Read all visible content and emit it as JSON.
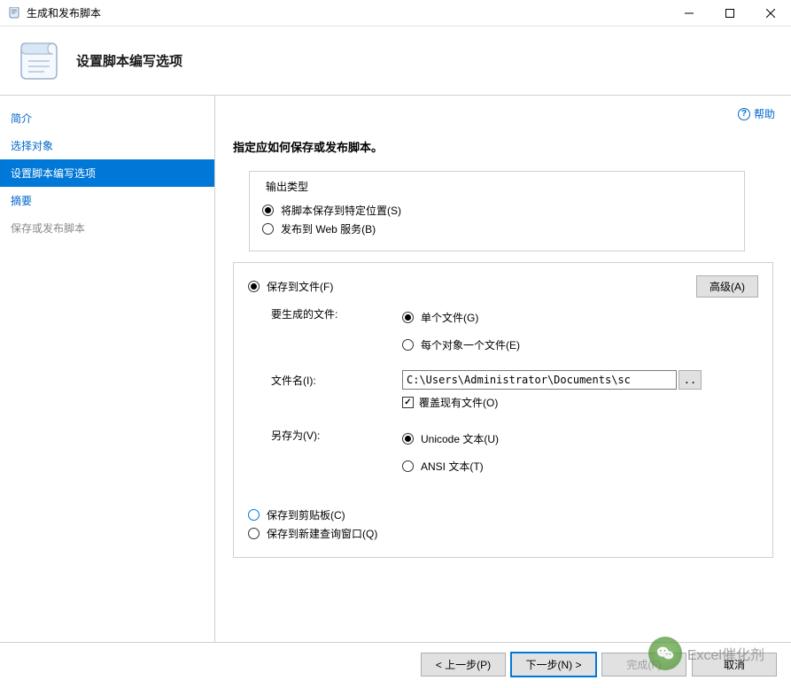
{
  "window": {
    "title": "生成和发布脚本"
  },
  "header": {
    "heading": "设置脚本编写选项"
  },
  "help": {
    "label": "帮助"
  },
  "sidebar": {
    "items": [
      {
        "label": "简介"
      },
      {
        "label": "选择对象"
      },
      {
        "label": "设置脚本编写选项"
      },
      {
        "label": "摘要"
      },
      {
        "label": "保存或发布脚本"
      }
    ]
  },
  "content": {
    "instruction": "指定应如何保存或发布脚本。",
    "output_type": {
      "legend": "输出类型",
      "save_location": "将脚本保存到特定位置(S)",
      "publish_web": "发布到 Web 服务(B)"
    },
    "save_file": {
      "radio": "保存到文件(F)",
      "advanced": "高级(A)",
      "files_label": "要生成的文件:",
      "single_file": "单个文件(G)",
      "per_object": "每个对象一个文件(E)",
      "filename_label": "文件名(I):",
      "filename_value": "C:\\Users\\Administrator\\Documents\\sc",
      "browse": "..",
      "overwrite": "覆盖现有文件(O)",
      "save_as_label": "另存为(V):",
      "unicode": "Unicode 文本(U)",
      "ansi": "ANSI 文本(T)"
    },
    "save_clipboard": "保存到剪贴板(C)",
    "save_query": "保存到新建查询窗口(Q)"
  },
  "footer": {
    "prev": "< 上一步(P)",
    "next": "下一步(N) >",
    "finish": "完成(F)",
    "cancel": "取消"
  },
  "watermark": {
    "text": "Excel催化剂"
  }
}
